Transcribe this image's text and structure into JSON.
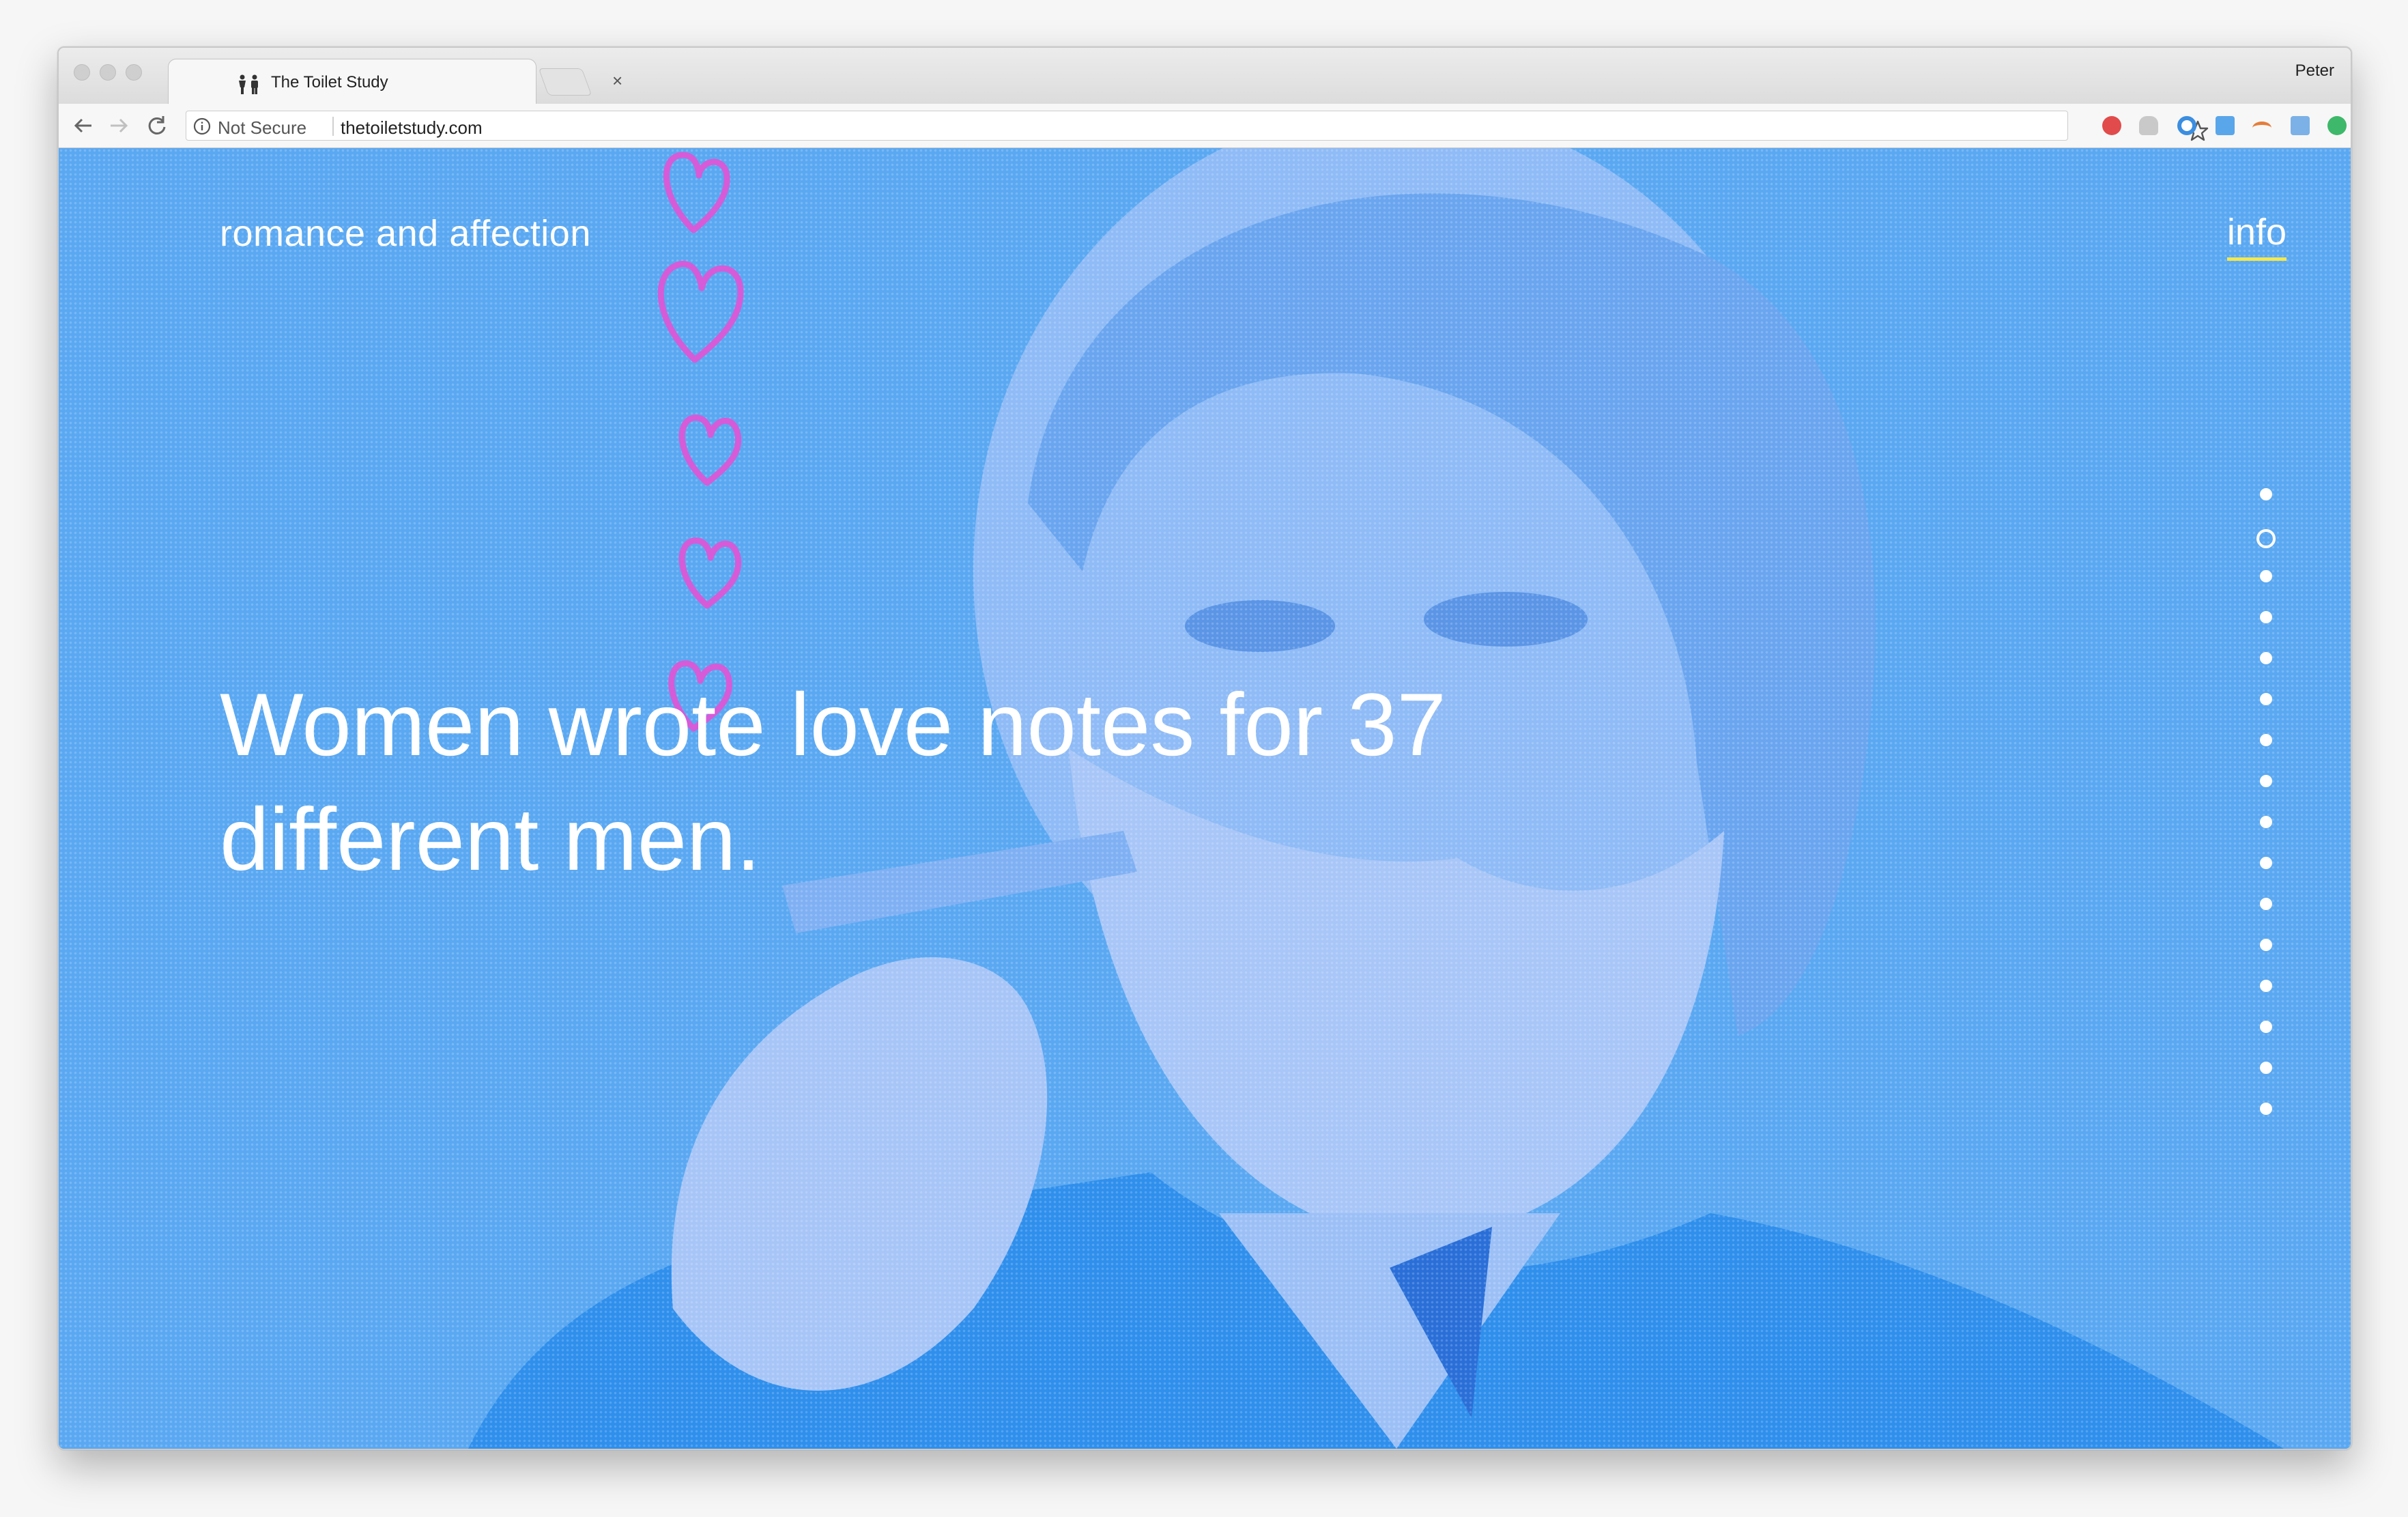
{
  "browser": {
    "tab_title": "The Toilet Study",
    "tab_close": "×",
    "profile_name": "Peter",
    "security_label": "Not Secure",
    "url": "thetoiletstudy.com",
    "menu_glyph": "⋮"
  },
  "page": {
    "section_label": "romance and affection",
    "info_link": "info",
    "headline": "Women wrote love notes for 37 different men.",
    "accent_underline_color": "#f5e84a",
    "background_color": "#4ea1f3",
    "heart_color": "#d65bd8"
  },
  "pagination": {
    "total": 16,
    "active_index": 1
  },
  "icons": {
    "tab_favicon": "restroom-icon",
    "back": "back-arrow-icon",
    "forward": "forward-arrow-icon",
    "reload": "reload-icon",
    "bookmark": "star-icon",
    "extensions": [
      "pinterest-icon",
      "cloud-icon",
      "circle-extension-icon",
      "bookmark-b-icon",
      "rainbow-icon",
      "calendar-icon",
      "leaf-icon",
      "info-extension-icon",
      "green-square-icon"
    ]
  }
}
